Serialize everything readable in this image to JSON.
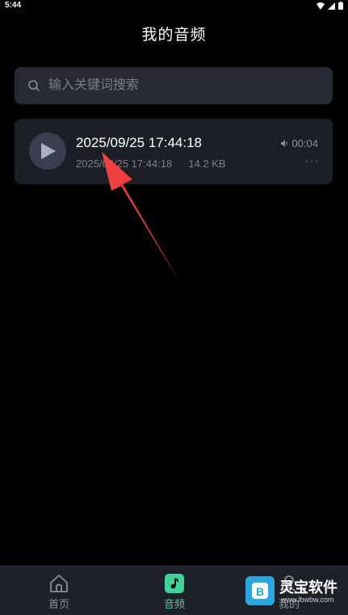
{
  "status_bar": {
    "time": "5:44"
  },
  "header": {
    "title": "我的音频"
  },
  "search": {
    "placeholder": "输入关键词搜索"
  },
  "audio_list": [
    {
      "title": "2025/09/25 17:44:18",
      "date": "2025/09/25 17:44:18",
      "size": "14.2 KB",
      "duration": "00:04",
      "more": "···"
    }
  ],
  "bottom_nav": {
    "items": [
      {
        "label": "首页",
        "icon": "home-icon",
        "active": false
      },
      {
        "label": "音频",
        "icon": "music-note-icon",
        "active": true
      },
      {
        "label": "我的",
        "icon": "user-icon",
        "active": false
      }
    ]
  },
  "watermark": {
    "text": "灵宝软件",
    "url": "www.lbwbw.com"
  },
  "colors": {
    "accent": "#3ed39a",
    "background": "#000000",
    "card": "#1c1f26",
    "arrow": "#f23f3f"
  }
}
